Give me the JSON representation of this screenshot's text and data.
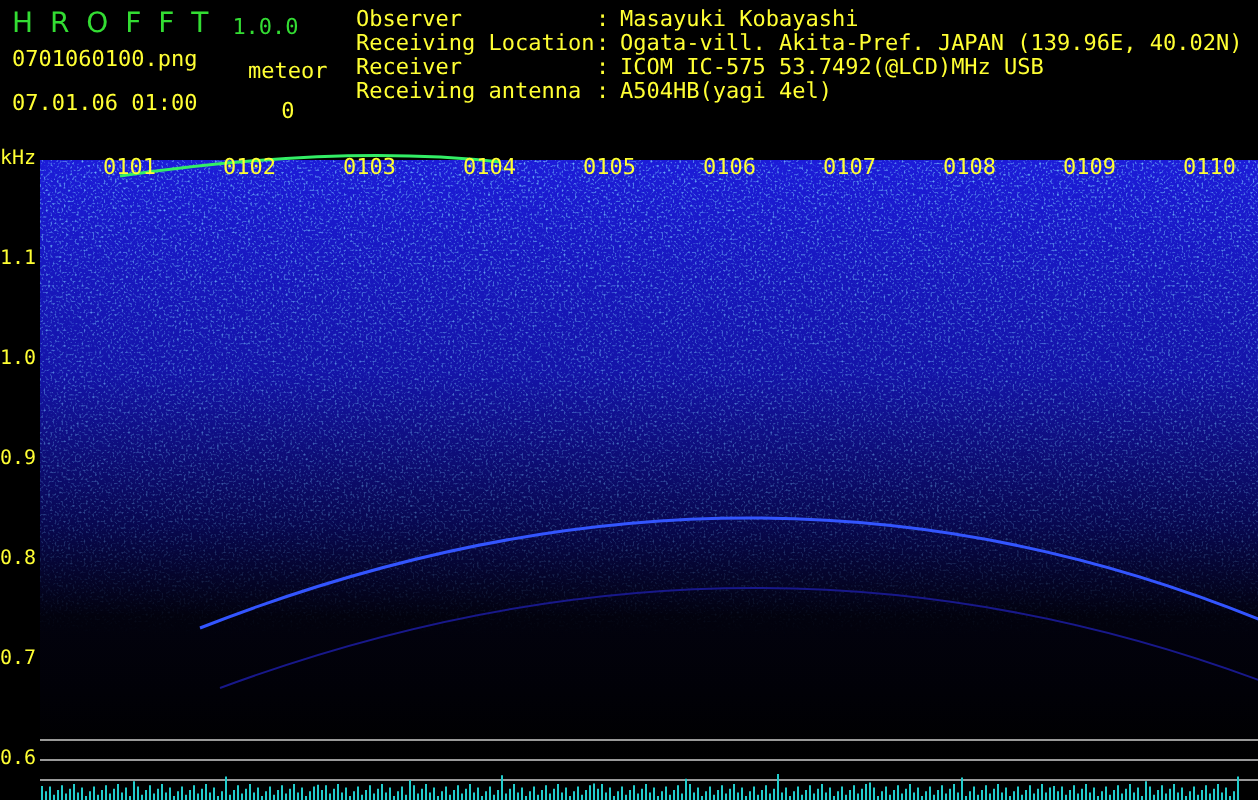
{
  "app": {
    "title": "H R O F F T",
    "version": "1.0.0"
  },
  "file": {
    "name": "0701060100.png",
    "datetime": "07.01.06 01:00"
  },
  "meteor": {
    "label": "meteor",
    "count": "0"
  },
  "station_info": [
    {
      "label": "Observer",
      "separator": ":",
      "value": "Masayuki Kobayashi"
    },
    {
      "label": "Receiving Location",
      "separator": ":",
      "value": "Ogata-vill. Akita-Pref. JAPAN (139.96E, 40.02N)"
    },
    {
      "label": "Receiver",
      "separator": ":",
      "value": "ICOM IC-575 53.7492(@LCD)MHz USB"
    },
    {
      "label": "Receiving antenna",
      "separator": ":",
      "value": "A504HB(yagi 4el)"
    }
  ],
  "spectrogram": {
    "y_unit": "kHz",
    "y_labels": [
      "1.1",
      "1.0",
      "0.9",
      "0.8",
      "0.7",
      "0.6"
    ],
    "time_labels": [
      "0101",
      "0102",
      "0103",
      "0104",
      "0105",
      "0106",
      "0107",
      "0108",
      "0109",
      "0110"
    ]
  }
}
